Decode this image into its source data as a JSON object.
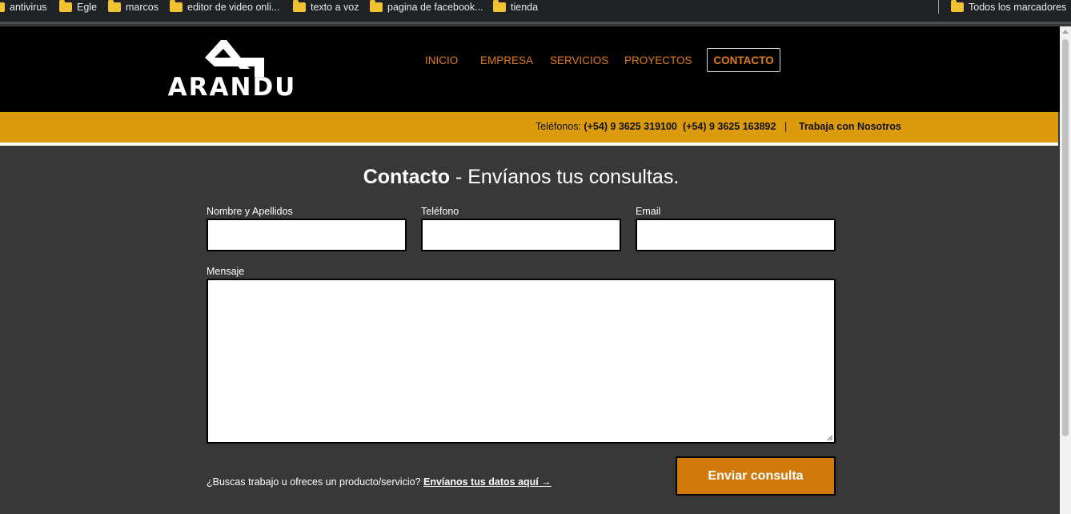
{
  "bookmarks": {
    "items": [
      {
        "label": "antivirus"
      },
      {
        "label": "Egle"
      },
      {
        "label": "marcos"
      },
      {
        "label": "editor de video onli..."
      },
      {
        "label": "texto a voz"
      },
      {
        "label": "pagina de facebook..."
      },
      {
        "label": "tienda"
      }
    ],
    "all_bookmarks": "Todos los marcadores"
  },
  "header": {
    "logo_text": "ARANDU",
    "nav": [
      "INICIO",
      "EMPRESA",
      "SERVICIOS",
      "PROYECTOS",
      "CONTACTO"
    ],
    "active_nav": "CONTACTO"
  },
  "infobar": {
    "phone_label": "Teléfonos:",
    "phone1": "(+54) 9 3625 319100",
    "phone2": "(+54) 9 3625 163892",
    "separator": "|",
    "work_link": "Trabaja con Nosotros"
  },
  "contact": {
    "title_bold": "Contacto",
    "title_rest": " - Envíanos tus consultas.",
    "fields": {
      "name_label": "Nombre y Apellidos",
      "name_value": "",
      "phone_label": "Teléfono",
      "phone_value": "",
      "email_label": "Email",
      "email_value": "",
      "message_label": "Mensaje",
      "message_value": ""
    },
    "bottom_text": "¿Buscas trabajo u ofreces un producto/servicio?",
    "bottom_link": "Envíanos tus datos aquí →",
    "submit_label": "Enviar consulta"
  },
  "colors": {
    "accent": "#e07b1a",
    "infobar": "#dc9a0d",
    "submit": "#d07a0c",
    "background": "#383838"
  }
}
